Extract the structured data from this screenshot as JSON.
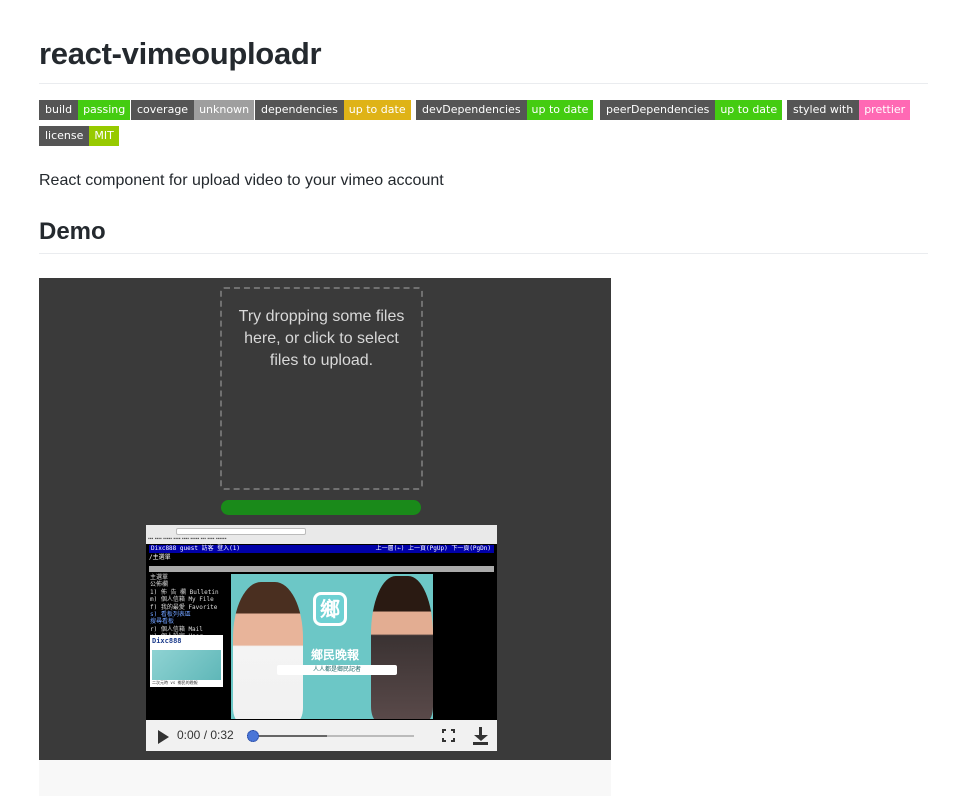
{
  "title": "react-vimeouploadr",
  "badges": [
    {
      "key": "build",
      "value": "passing",
      "color": "#4c1"
    },
    {
      "key": "coverage",
      "value": "unknown",
      "color": "#9f9f9f"
    },
    {
      "key": "dependencies",
      "value": "up to date",
      "color": "#dfb317"
    },
    {
      "key": "devDependencies",
      "value": "up to date",
      "color": "#4c1"
    },
    {
      "key": "peerDependencies",
      "value": "up to date",
      "color": "#4c1"
    },
    {
      "key": "styled with",
      "value": "prettier",
      "color": "#ff69b4"
    },
    {
      "key": "license",
      "value": "MIT",
      "color": "#97ca00"
    }
  ],
  "description": "React component for upload video to your vimeo account",
  "demo_heading": "Demo",
  "dropzone": {
    "lines": [
      "Try dropping some files",
      "here, or click to select",
      "files to upload."
    ]
  },
  "upload_progress": 1.0,
  "video": {
    "time": "0:00 / 0:32",
    "progress": 0.0,
    "buffered": 0.45,
    "terminal": {
      "header_left": "Dixc888 guest 訪客 登入(1)",
      "header_right": "上一層(←) 上一頁(PgUp) 下一頁(PgDn)",
      "subtitle": "/主選單",
      "menu": [
        {
          "text": "主選單",
          "hl": false
        },
        {
          "text": "   公佈欄",
          "hl": false
        },
        {
          "text": "1) 佈 告 欄 Bulletin",
          "hl": false
        },
        {
          "text": "m) 個人信箱 My File",
          "hl": false
        },
        {
          "text": "f) 我的最愛 Favorite",
          "hl": false
        },
        {
          "text": "s) 看板列表區",
          "hl": true
        },
        {
          "text": "   搜尋看板",
          "hl": true
        },
        {
          "text": "r) 個人信箱 Mail",
          "hl": false
        },
        {
          "text": "u) 個人設定 User",
          "hl": false
        },
        {
          "text": "x) 離  開",
          "hl": false
        }
      ],
      "ad_logo": "Dixc888",
      "ad_caption": "二次元時 vs 鄉民的晚報"
    },
    "poster": {
      "icon_char": "鄉",
      "app_name": "鄉民晚報",
      "tagline": "人人都是鄉民記者"
    }
  }
}
